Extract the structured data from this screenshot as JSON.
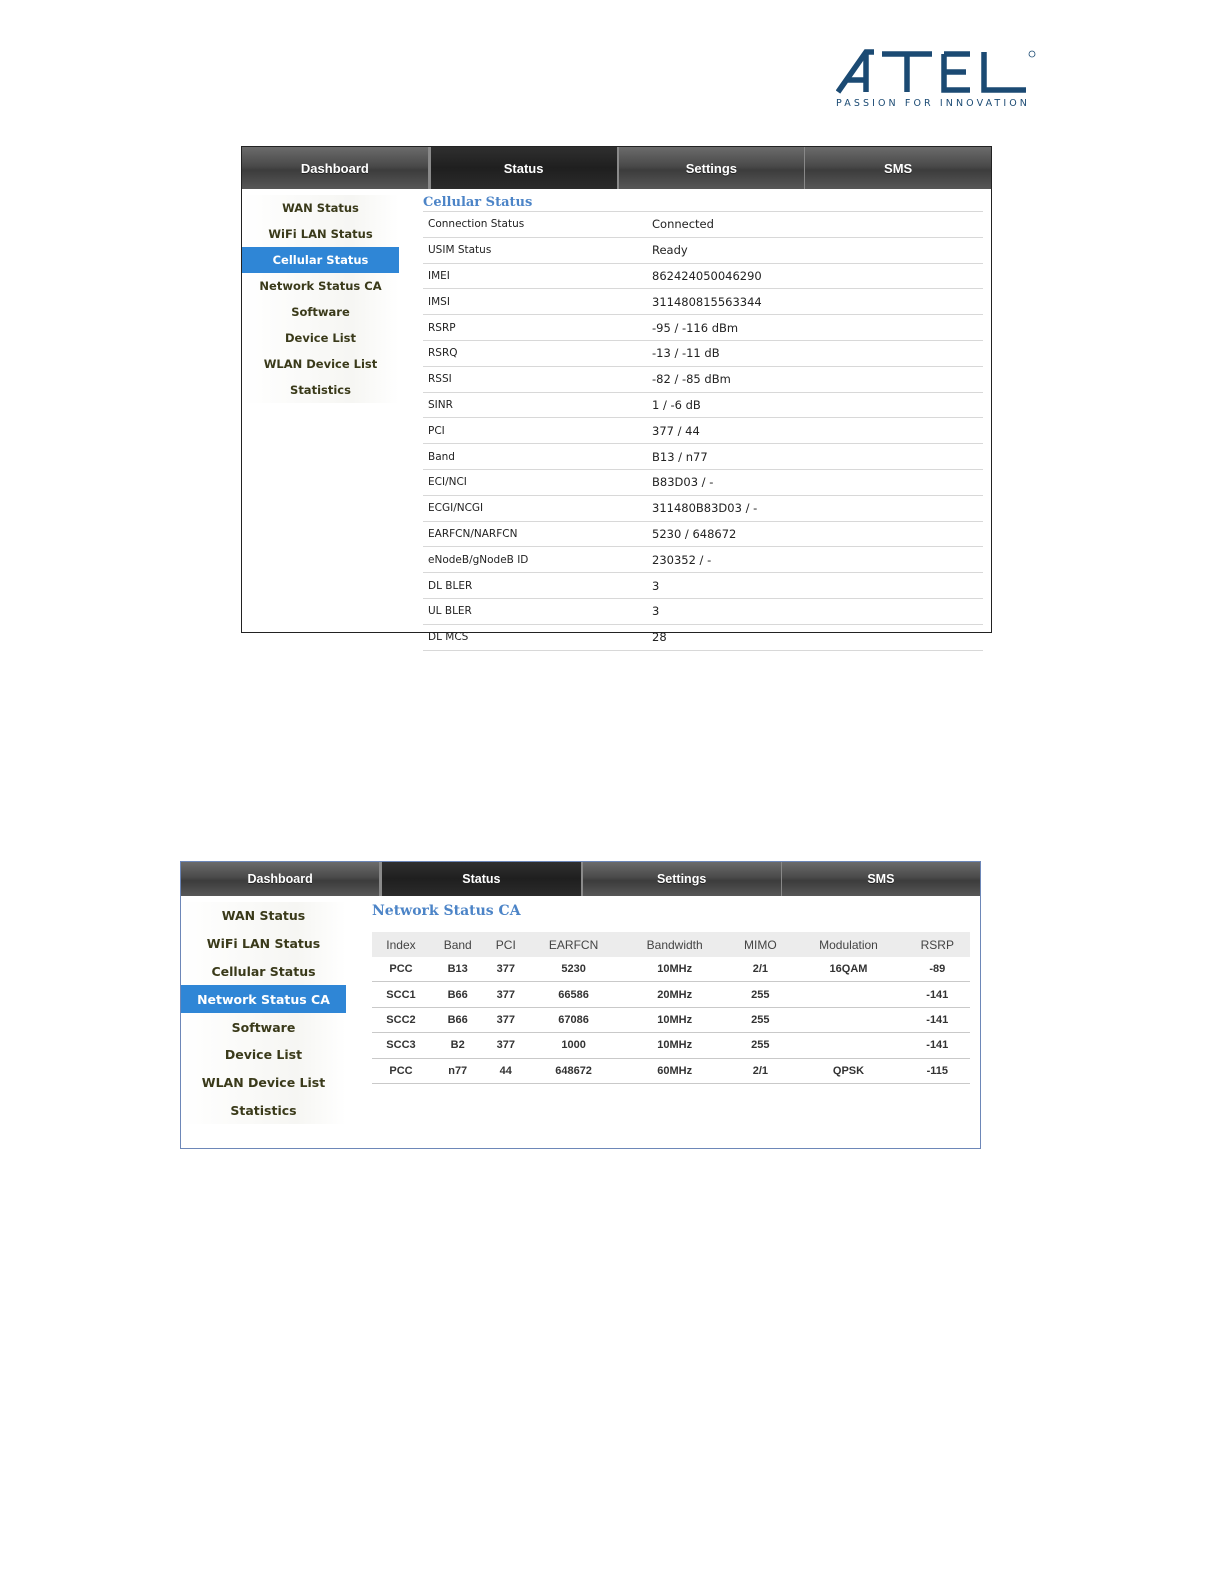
{
  "logo": {
    "wordmark": "ATEL",
    "tagline": "PASSION FOR INNOVATION",
    "brand_color": "#1b4a73"
  },
  "screen1": {
    "nav": [
      "Dashboard",
      "Status",
      "Settings",
      "SMS"
    ],
    "sidebar": [
      "WAN Status",
      "WiFi LAN Status",
      "Cellular Status",
      "Network Status CA",
      "Software",
      "Device List",
      "WLAN Device List",
      "Statistics"
    ],
    "title": "Cellular Status",
    "rows": [
      {
        "key": "Connection Status",
        "value": "Connected"
      },
      {
        "key": "USIM Status",
        "value": "Ready"
      },
      {
        "key": "IMEI",
        "value": "862424050046290"
      },
      {
        "key": "IMSI",
        "value": "311480815563344"
      },
      {
        "key": "RSRP",
        "value": "-95 / -116 dBm"
      },
      {
        "key": "RSRQ",
        "value": "-13 / -11 dB"
      },
      {
        "key": "RSSI",
        "value": "-82 / -85 dBm"
      },
      {
        "key": "SINR",
        "value": "1 / -6 dB"
      },
      {
        "key": "PCI",
        "value": "377 / 44"
      },
      {
        "key": "Band",
        "value": "B13 / n77"
      },
      {
        "key": "ECI/NCI",
        "value": "B83D03 / -"
      },
      {
        "key": "ECGI/NCGI",
        "value": "311480B83D03 / -"
      },
      {
        "key": "EARFCN/NARFCN",
        "value": "5230 / 648672"
      },
      {
        "key": "eNodeB/gNodeB ID",
        "value": "230352 / -"
      },
      {
        "key": "DL BLER",
        "value": "3"
      },
      {
        "key": "UL BLER",
        "value": "3"
      },
      {
        "key": "DL MCS",
        "value": "28"
      }
    ]
  },
  "screen2": {
    "nav": [
      "Dashboard",
      "Status",
      "Settings",
      "SMS"
    ],
    "sidebar": [
      "WAN Status",
      "WiFi LAN Status",
      "Cellular Status",
      "Network Status CA",
      "Software",
      "Device List",
      "WLAN Device List",
      "Statistics"
    ],
    "title": "Network Status CA",
    "columns": [
      "Index",
      "Band",
      "PCI",
      "EARFCN",
      "Bandwidth",
      "MIMO",
      "Modulation",
      "RSRP"
    ],
    "rows": [
      [
        "PCC",
        "B13",
        "377",
        "5230",
        "10MHz",
        "2/1",
        "16QAM",
        "-89"
      ],
      [
        "SCC1",
        "B66",
        "377",
        "66586",
        "20MHz",
        "255",
        "",
        "-141"
      ],
      [
        "SCC2",
        "B66",
        "377",
        "67086",
        "10MHz",
        "255",
        "",
        "-141"
      ],
      [
        "SCC3",
        "B2",
        "377",
        "1000",
        "10MHz",
        "255",
        "",
        "-141"
      ],
      [
        "PCC",
        "n77",
        "44",
        "648672",
        "60MHz",
        "2/1",
        "QPSK",
        "-115"
      ]
    ]
  }
}
